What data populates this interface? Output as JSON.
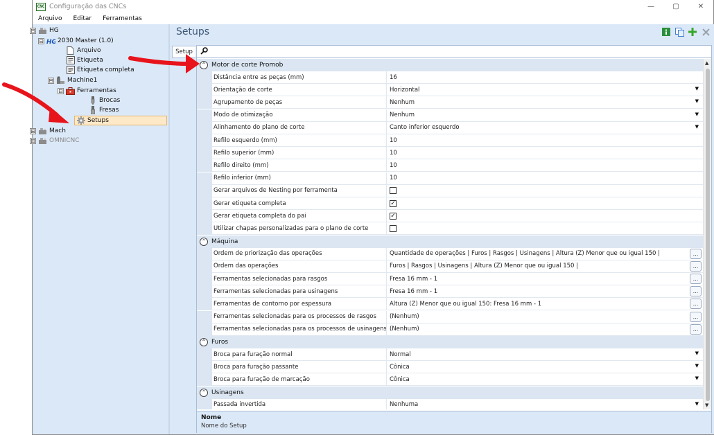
{
  "window": {
    "title": "Configuração das CNCs",
    "app_icon_text": "CNC",
    "controls": {
      "minimize": "—",
      "maximize": "▢",
      "close": "✕"
    }
  },
  "menu": [
    "Arquivo",
    "Editar",
    "Ferramentas"
  ],
  "tree": [
    {
      "label": "HG",
      "icon": "machine-group-icon",
      "expander": "⊟"
    },
    {
      "label": "2030 Master (1.0)",
      "icon": "hg-logo-icon",
      "expander": "⊟"
    },
    {
      "label": "Arquivo",
      "icon": "file-icon"
    },
    {
      "label": "Etiqueta",
      "icon": "label-icon"
    },
    {
      "label": "Etiqueta completa",
      "icon": "label-icon"
    },
    {
      "label": "Machine1",
      "icon": "machine-icon",
      "expander": "⊟"
    },
    {
      "label": "Ferramentas",
      "icon": "toolbox-icon",
      "expander": "⊟"
    },
    {
      "label": "Brocas",
      "icon": "drill-bit-icon"
    },
    {
      "label": "Fresas",
      "icon": "router-bit-icon"
    },
    {
      "label": "Setups",
      "icon": "gear-icon",
      "selected": true
    },
    {
      "label": "Mach",
      "icon": "machine-group-icon",
      "expander": "⊞"
    },
    {
      "label": "OMNICNC",
      "icon": "machine-group-icon",
      "expander": "⊞",
      "disabled": true
    }
  ],
  "header": {
    "title": "Setups",
    "icons": [
      "info-icon",
      "copy-icon",
      "add-icon",
      "delete-icon"
    ]
  },
  "tab": "Setup",
  "search": {
    "icon": "search-icon",
    "placeholder": ""
  },
  "categories": [
    {
      "label": "Motor de corte Promob",
      "rows": [
        {
          "name": "Distância entre as peças (mm)",
          "value": "16"
        },
        {
          "name": "Orientação de corte",
          "value": "Horizontal",
          "editor": "dropdown"
        },
        {
          "name": "Agrupamento de peças",
          "value": "Nenhum",
          "editor": "dropdown"
        },
        {
          "name": "Modo de otimização",
          "value": "Nenhum",
          "editor": "dropdown"
        },
        {
          "name": "Alinhamento do plano de corte",
          "value": "Canto inferior esquerdo",
          "editor": "dropdown"
        },
        {
          "name": "Refilo esquerdo (mm)",
          "value": "10"
        },
        {
          "name": "Refilo superior (mm)",
          "value": "10"
        },
        {
          "name": "Refilo direito (mm)",
          "value": "10"
        },
        {
          "name": "Refilo inferior (mm)",
          "value": "10"
        },
        {
          "name": "Gerar arquivos de Nesting por ferramenta",
          "checked": false,
          "editor": "checkbox"
        },
        {
          "name": "Gerar etiqueta completa",
          "checked": true,
          "editor": "checkbox"
        },
        {
          "name": "Gerar etiqueta completa do pai",
          "checked": true,
          "editor": "checkbox"
        },
        {
          "name": "Utilizar chapas personalizadas para o plano de corte",
          "checked": false,
          "editor": "checkbox"
        }
      ]
    },
    {
      "label": "Máquina",
      "rows": [
        {
          "name": "Ordem de priorização das operações",
          "value": "Quantidade de operações | Furos | Rasgos | Usinagens | Altura (Z) Menor que ou igual 150 |",
          "editor": "ellipsis"
        },
        {
          "name": "Ordem das operações",
          "value": "Furos | Rasgos | Usinagens | Altura (Z) Menor que ou igual 150 |",
          "editor": "ellipsis"
        },
        {
          "name": "Ferramentas selecionadas para rasgos",
          "value": "Fresa 16 mm - 1",
          "editor": "ellipsis"
        },
        {
          "name": "Ferramentas selecionadas para usinagens",
          "value": "Fresa 16 mm - 1",
          "editor": "ellipsis"
        },
        {
          "name": "Ferramentas de contorno por espessura",
          "value": "Altura (Z) Menor que ou igual 150: Fresa 16 mm - 1",
          "editor": "ellipsis"
        },
        {
          "name": "Ferramentas selecionadas para os processos de rasgos",
          "value": "(Nenhum)",
          "editor": "ellipsis"
        },
        {
          "name": "Ferramentas selecionadas para os processos de usinagens",
          "value": "(Nenhum)",
          "editor": "ellipsis"
        }
      ]
    },
    {
      "label": "Furos",
      "rows": [
        {
          "name": "Broca para furação normal",
          "value": "Normal",
          "editor": "dropdown"
        },
        {
          "name": "Broca para furação passante",
          "value": "Cônica",
          "editor": "dropdown"
        },
        {
          "name": "Broca para furação de marcação",
          "value": "Cônica",
          "editor": "dropdown"
        }
      ]
    },
    {
      "label": "Usinagens",
      "rows": [
        {
          "name": "Passada invertida",
          "value": "Nenhuma",
          "editor": "dropdown"
        }
      ]
    }
  ],
  "description": {
    "title": "Nome",
    "text": "Nome do Setup"
  },
  "glyphs": {
    "collapse": "⌃",
    "dropdown": "▼",
    "ellipsis": "...",
    "check": "✓",
    "scroll_up": "▲",
    "scroll_down": "▼"
  },
  "colors": {
    "arrow": "#e8141b",
    "selection": "#fde9c8",
    "panel_bg": "#dbe8f7"
  }
}
